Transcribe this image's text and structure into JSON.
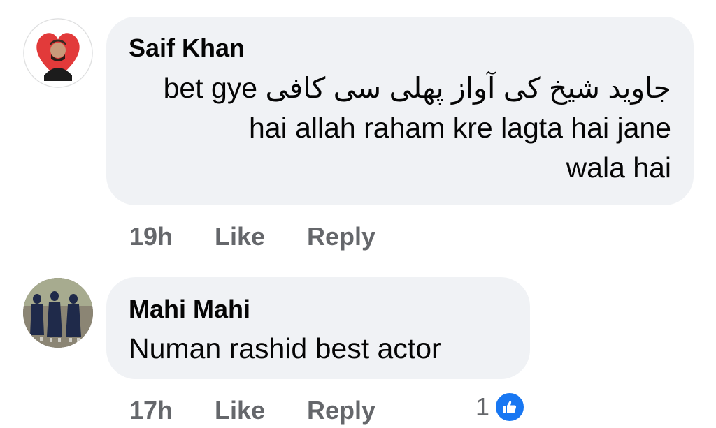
{
  "comments": [
    {
      "author": "Saif Khan",
      "lines": [
        "جاوید شیخ کی آواز پھلی سی کافی bet gye",
        "hai allah raham kre lagta hai jane",
        "wala hai"
      ],
      "time": "19h",
      "like_label": "Like",
      "reply_label": "Reply",
      "avatar": "avatar-man-heart"
    },
    {
      "author": "Mahi Mahi",
      "lines": [
        "Numan rashid best actor"
      ],
      "time": "17h",
      "like_label": "Like",
      "reply_label": "Reply",
      "reaction_count": "1",
      "reaction_icon": "thumbs-up-icon",
      "avatar": "avatar-group-photo"
    }
  ],
  "colors": {
    "bubble": "#f0f2f5",
    "meta": "#65676b",
    "like_blue": "#1877f2"
  }
}
